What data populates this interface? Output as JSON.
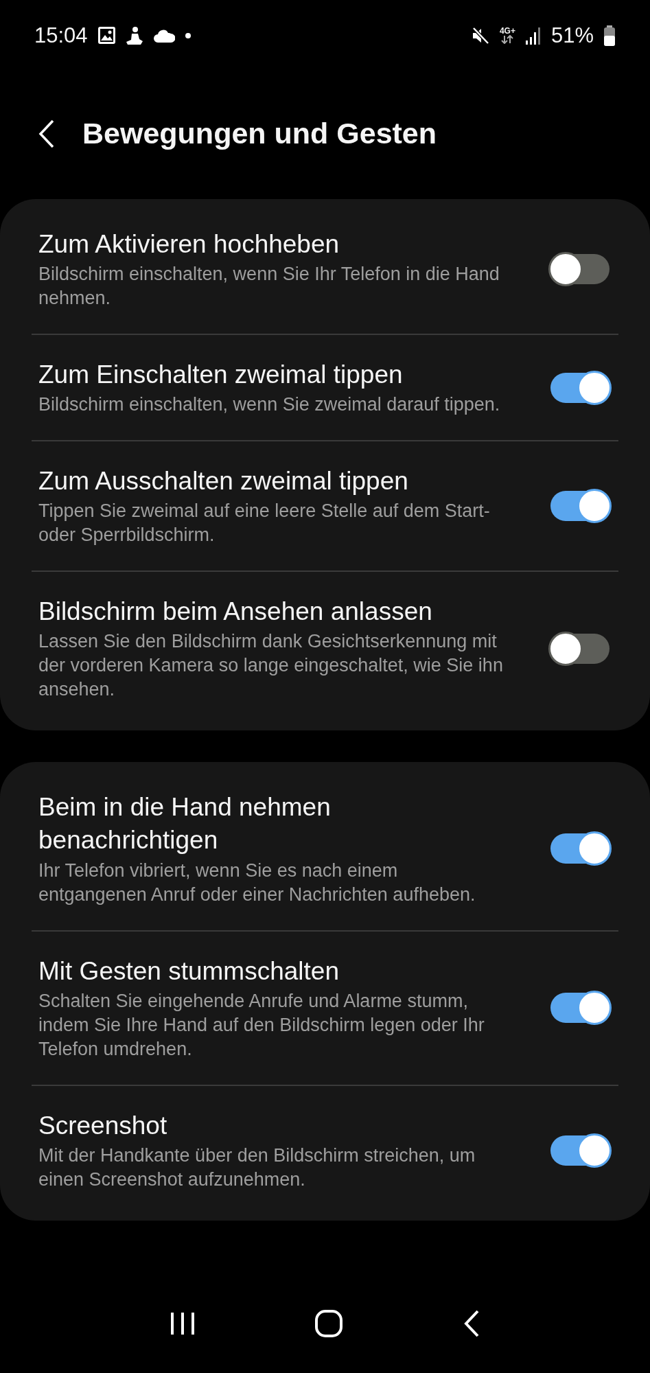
{
  "status_bar": {
    "time": "15:04",
    "network": "4G+",
    "battery": "51%"
  },
  "header": {
    "title": "Bewegungen und Gesten"
  },
  "groups": [
    {
      "items": [
        {
          "title": "Zum Aktivieren hochheben",
          "description": "Bildschirm einschalten, wenn Sie Ihr Telefon in die Hand nehmen.",
          "on": false
        },
        {
          "title": "Zum Einschalten zweimal tippen",
          "description": "Bildschirm einschalten, wenn Sie zweimal darauf tippen.",
          "on": true
        },
        {
          "title": "Zum Ausschalten zweimal tippen",
          "description": "Tippen Sie zweimal auf eine leere Stelle auf dem Start- oder Sperrbildschirm.",
          "on": true
        },
        {
          "title": "Bildschirm beim Ansehen anlassen",
          "description": "Lassen Sie den Bildschirm dank Gesichtserkennung mit der vorderen Kamera so lange eingeschaltet, wie Sie ihn ansehen.",
          "on": false
        }
      ]
    },
    {
      "items": [
        {
          "title": "Beim in die Hand nehmen benachrichtigen",
          "description": "Ihr Telefon vibriert, wenn Sie es nach einem entgangenen Anruf oder einer Nachrichten aufheben.",
          "on": true
        },
        {
          "title": "Mit Gesten stummschalten",
          "description": "Schalten Sie eingehende Anrufe und Alarme stumm, indem Sie Ihre Hand auf den Bildschirm legen oder Ihr Telefon umdrehen.",
          "on": true
        },
        {
          "title": "Screenshot",
          "description": "Mit der Handkante über den Bildschirm streichen, um einen Screenshot aufzunehmen.",
          "on": true
        }
      ]
    }
  ]
}
